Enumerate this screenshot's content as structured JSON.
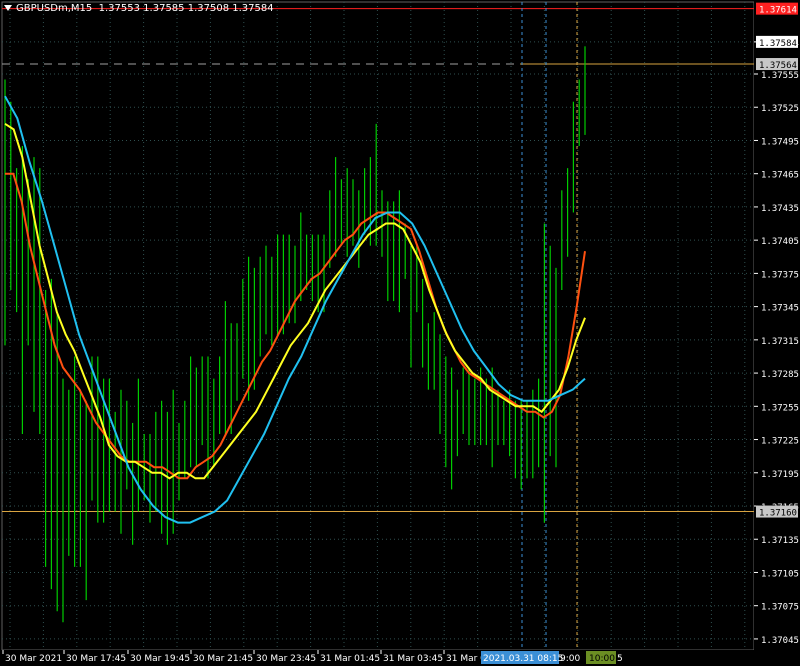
{
  "header": {
    "symbol": "GBPUSDm,M15",
    "ohlc": "1.37553 1.37585 1.37508 1.37584"
  },
  "colors": {
    "background": "#000000",
    "grid": "#2f4f4f",
    "candle": "#00cc00",
    "ma_fast": "#ff5010",
    "ma_mid": "#ffff20",
    "ma_slow": "#20c0f0",
    "top_line": "#ff2020",
    "hline": "#d9a441",
    "price_tag_current": "#ffffff",
    "price_tag_red": "#ff2020",
    "price_tag_level": "#c8c8c8",
    "vline_blue": "#3b8fd6",
    "vline_orange": "#d9a441"
  },
  "chart_data": {
    "type": "line",
    "title": "GBPUSDm,M15",
    "y_ticks": [
      "1.37584",
      "1.37555",
      "1.37525",
      "1.37495",
      "1.37465",
      "1.37435",
      "1.37405",
      "1.37375",
      "1.37345",
      "1.37315",
      "1.37285",
      "1.37255",
      "1.37225",
      "1.37195",
      "1.37165",
      "1.37135",
      "1.37105",
      "1.37075",
      "1.37045"
    ],
    "x_ticks": [
      "30 Mar 2021",
      "30 Mar 17:45",
      "30 Mar 19:45",
      "30 Mar 21:45",
      "30 Mar 23:45",
      "31 Mar 01:45",
      "31 Mar 03:45",
      "31 Mar 05"
    ],
    "ylim": [
      1.37035,
      1.3762
    ],
    "price_labels": {
      "red": "1.37614",
      "current": "1.37584",
      "level_upper": "1.37564",
      "level_lower": "1.37160"
    },
    "time_labels": {
      "blue": "2021.03.31 08:15",
      "plain": "9:00",
      "green": "10:00",
      "tail": "5"
    },
    "candles": [
      {
        "h": 1.3755,
        "l": 1.3731
      },
      {
        "h": 1.3753,
        "l": 1.3736
      },
      {
        "h": 1.3747,
        "l": 1.3734
      },
      {
        "h": 1.3749,
        "l": 1.3723
      },
      {
        "h": 1.3746,
        "l": 1.3731
      },
      {
        "h": 1.3748,
        "l": 1.3725
      },
      {
        "h": 1.3747,
        "l": 1.3723
      },
      {
        "h": 1.3736,
        "l": 1.3711
      },
      {
        "h": 1.3737,
        "l": 1.3709
      },
      {
        "h": 1.3734,
        "l": 1.3707
      },
      {
        "h": 1.3728,
        "l": 1.3706
      },
      {
        "h": 1.3727,
        "l": 1.3712
      },
      {
        "h": 1.373,
        "l": 1.3711
      },
      {
        "h": 1.3727,
        "l": 1.3711
      },
      {
        "h": 1.3726,
        "l": 1.3708
      },
      {
        "h": 1.373,
        "l": 1.3717
      },
      {
        "h": 1.373,
        "l": 1.3715
      },
      {
        "h": 1.3728,
        "l": 1.3715
      },
      {
        "h": 1.3728,
        "l": 1.3716
      },
      {
        "h": 1.3725,
        "l": 1.3716
      },
      {
        "h": 1.3727,
        "l": 1.3714
      },
      {
        "h": 1.3726,
        "l": 1.3718
      },
      {
        "h": 1.3724,
        "l": 1.3713
      },
      {
        "h": 1.3728,
        "l": 1.3716
      },
      {
        "h": 1.3723,
        "l": 1.3717
      },
      {
        "h": 1.3723,
        "l": 1.3715
      },
      {
        "h": 1.3725,
        "l": 1.3716
      },
      {
        "h": 1.3726,
        "l": 1.3714
      },
      {
        "h": 1.3725,
        "l": 1.3713
      },
      {
        "h": 1.3727,
        "l": 1.3714
      },
      {
        "h": 1.3724,
        "l": 1.3717
      },
      {
        "h": 1.3726,
        "l": 1.3719
      },
      {
        "h": 1.373,
        "l": 1.372
      },
      {
        "h": 1.3729,
        "l": 1.372
      },
      {
        "h": 1.373,
        "l": 1.3722
      },
      {
        "h": 1.373,
        "l": 1.3719
      },
      {
        "h": 1.3728,
        "l": 1.372
      },
      {
        "h": 1.373,
        "l": 1.3723
      },
      {
        "h": 1.3735,
        "l": 1.3723
      },
      {
        "h": 1.3733,
        "l": 1.3723
      },
      {
        "h": 1.3733,
        "l": 1.3726
      },
      {
        "h": 1.3737,
        "l": 1.3728
      },
      {
        "h": 1.3739,
        "l": 1.3726
      },
      {
        "h": 1.3738,
        "l": 1.3727
      },
      {
        "h": 1.3739,
        "l": 1.373
      },
      {
        "h": 1.374,
        "l": 1.3732
      },
      {
        "h": 1.3739,
        "l": 1.3731
      },
      {
        "h": 1.3741,
        "l": 1.3732
      },
      {
        "h": 1.3741,
        "l": 1.3732
      },
      {
        "h": 1.3741,
        "l": 1.3733
      },
      {
        "h": 1.374,
        "l": 1.3733
      },
      {
        "h": 1.3743,
        "l": 1.3735
      },
      {
        "h": 1.3741,
        "l": 1.3736
      },
      {
        "h": 1.3741,
        "l": 1.3735
      },
      {
        "h": 1.3741,
        "l": 1.3734
      },
      {
        "h": 1.3741,
        "l": 1.3734
      },
      {
        "h": 1.3745,
        "l": 1.3738
      },
      {
        "h": 1.3748,
        "l": 1.3739
      },
      {
        "h": 1.3746,
        "l": 1.374
      },
      {
        "h": 1.3747,
        "l": 1.3739
      },
      {
        "h": 1.3746,
        "l": 1.374
      },
      {
        "h": 1.3745,
        "l": 1.3738
      },
      {
        "h": 1.3747,
        "l": 1.3741
      },
      {
        "h": 1.3748,
        "l": 1.374
      },
      {
        "h": 1.3751,
        "l": 1.374
      },
      {
        "h": 1.3745,
        "l": 1.3739
      },
      {
        "h": 1.3744,
        "l": 1.3735
      },
      {
        "h": 1.3744,
        "l": 1.3735
      },
      {
        "h": 1.3745,
        "l": 1.3734
      },
      {
        "h": 1.3742,
        "l": 1.3737
      },
      {
        "h": 1.374,
        "l": 1.3729
      },
      {
        "h": 1.374,
        "l": 1.3734
      },
      {
        "h": 1.3737,
        "l": 1.3729
      },
      {
        "h": 1.3733,
        "l": 1.3727
      },
      {
        "h": 1.3734,
        "l": 1.3727
      },
      {
        "h": 1.3732,
        "l": 1.3723
      },
      {
        "h": 1.373,
        "l": 1.372
      },
      {
        "h": 1.3729,
        "l": 1.3718
      },
      {
        "h": 1.3727,
        "l": 1.3721
      },
      {
        "h": 1.3729,
        "l": 1.3723
      },
      {
        "h": 1.3729,
        "l": 1.3722
      },
      {
        "h": 1.3728,
        "l": 1.3722
      },
      {
        "h": 1.3729,
        "l": 1.3722
      },
      {
        "h": 1.3728,
        "l": 1.3722
      },
      {
        "h": 1.3729,
        "l": 1.372
      },
      {
        "h": 1.3727,
        "l": 1.3722
      },
      {
        "h": 1.3726,
        "l": 1.3722
      },
      {
        "h": 1.3727,
        "l": 1.3721
      },
      {
        "h": 1.3726,
        "l": 1.3719
      },
      {
        "h": 1.3726,
        "l": 1.3718
      },
      {
        "h": 1.3726,
        "l": 1.3719
      },
      {
        "h": 1.3727,
        "l": 1.3719
      },
      {
        "h": 1.3728,
        "l": 1.372
      },
      {
        "h": 1.3742,
        "l": 1.3715
      },
      {
        "h": 1.374,
        "l": 1.3721
      },
      {
        "h": 1.3738,
        "l": 1.372
      },
      {
        "h": 1.3745,
        "l": 1.3736
      },
      {
        "h": 1.3747,
        "l": 1.3739
      },
      {
        "h": 1.3753,
        "l": 1.3743
      },
      {
        "h": 1.3755,
        "l": 1.3749
      },
      {
        "h": 1.3758,
        "l": 1.375
      }
    ],
    "series": [
      {
        "values": [
          1.37465,
          1.37465,
          1.3744,
          1.374,
          1.3737,
          1.3734,
          1.3731,
          1.3729,
          1.3728,
          1.3727,
          1.37255,
          1.3724,
          1.3723,
          1.3722,
          1.3721,
          1.37205,
          1.37205,
          1.37205,
          1.372,
          1.372,
          1.37195,
          1.3719,
          1.3719,
          1.372,
          1.37205,
          1.3721,
          1.3722,
          1.37235,
          1.3725,
          1.37265,
          1.3728,
          1.37295,
          1.37305,
          1.3732,
          1.37335,
          1.3735,
          1.3736,
          1.3737,
          1.37375,
          1.37385,
          1.37395,
          1.37405,
          1.3741,
          1.3742,
          1.37425,
          1.3743,
          1.3743,
          1.37425,
          1.3742,
          1.37415,
          1.37395,
          1.3737,
          1.37345,
          1.37325,
          1.3731,
          1.37295,
          1.37285,
          1.3728,
          1.37275,
          1.3727,
          1.37265,
          1.3726,
          1.37255,
          1.3725,
          1.3725,
          1.37245,
          1.3725,
          1.37265,
          1.373,
          1.37345,
          1.37395
        ]
      },
      {
        "values": [
          1.3751,
          1.37505,
          1.3748,
          1.3744,
          1.374,
          1.3737,
          1.3734,
          1.3732,
          1.37305,
          1.37285,
          1.37265,
          1.37245,
          1.3722,
          1.3721,
          1.37205,
          1.37205,
          1.372,
          1.37195,
          1.37195,
          1.3719,
          1.37195,
          1.37195,
          1.3719,
          1.3719,
          1.372,
          1.3721,
          1.3722,
          1.3723,
          1.3724,
          1.3725,
          1.37265,
          1.3728,
          1.37295,
          1.3731,
          1.3732,
          1.3733,
          1.37345,
          1.3736,
          1.3737,
          1.3738,
          1.3739,
          1.374,
          1.3741,
          1.37415,
          1.3742,
          1.3742,
          1.37415,
          1.374,
          1.37385,
          1.3736,
          1.3734,
          1.3732,
          1.37305,
          1.37295,
          1.37285,
          1.3728,
          1.3727,
          1.37265,
          1.3726,
          1.37255,
          1.37255,
          1.37255,
          1.3725,
          1.3726,
          1.3727,
          1.3729,
          1.37315,
          1.37335
        ]
      },
      {
        "values": [
          1.37535,
          1.37515,
          1.37475,
          1.3744,
          1.374,
          1.3736,
          1.3732,
          1.3729,
          1.3726,
          1.3723,
          1.372,
          1.3718,
          1.37165,
          1.37155,
          1.3715,
          1.3715,
          1.37155,
          1.3716,
          1.3717,
          1.3719,
          1.3721,
          1.3723,
          1.37255,
          1.3728,
          1.373,
          1.37325,
          1.3735,
          1.3737,
          1.3739,
          1.3741,
          1.37425,
          1.3743,
          1.3743,
          1.3742,
          1.374,
          1.37375,
          1.3735,
          1.37325,
          1.37305,
          1.3729,
          1.37275,
          1.37265,
          1.3726,
          1.3726,
          1.3726,
          1.37265,
          1.3727,
          1.3728
        ]
      }
    ]
  }
}
